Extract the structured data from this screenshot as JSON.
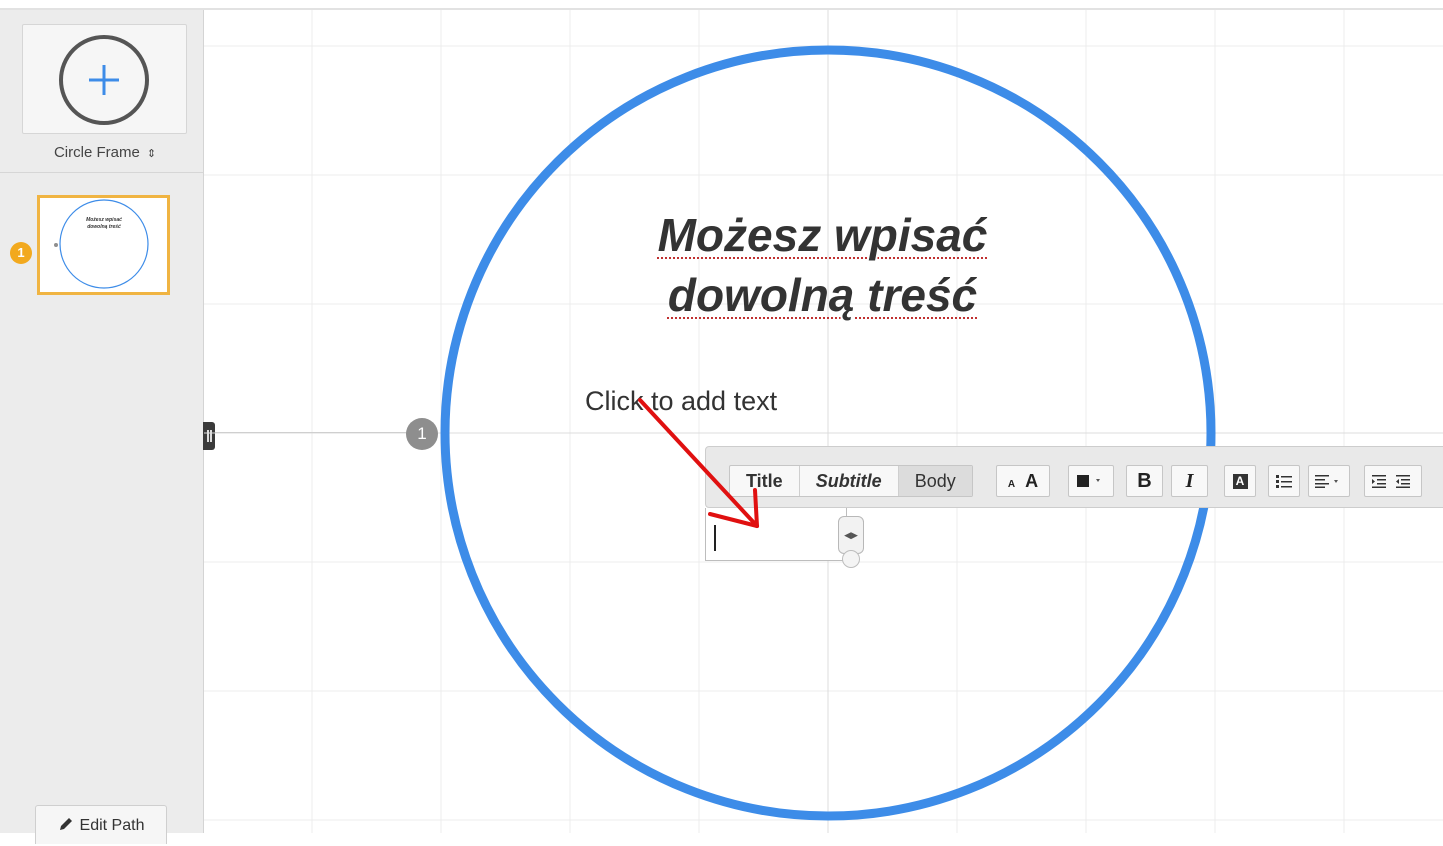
{
  "sidebar": {
    "add_frame_label": "",
    "frame_type": "Circle Frame",
    "slides": [
      {
        "number": "1",
        "title_line1": "Możesz wpisać",
        "title_line2": "dowolną treść"
      }
    ],
    "edit_path_label": "Edit Path"
  },
  "canvas": {
    "path_marker": "1",
    "frame_title_line1": "Możesz wpisać",
    "frame_title_line2": "dowolną treść",
    "placeholder_text": "Click to add text",
    "frame_color": "#3d8ce8",
    "annotation_arrow_color": "#e01010"
  },
  "toolbar": {
    "style_buttons": [
      "Title",
      "Subtitle",
      "Body"
    ],
    "selected_style": "Body",
    "font_size_small": "A",
    "font_size_large": "A",
    "bold_label": "B",
    "italic_label": "I",
    "highlight_label": "A",
    "icons": [
      "color-picker-icon",
      "bullet-list-icon",
      "align-icon",
      "indent-decrease-icon",
      "indent-increase-icon"
    ]
  }
}
